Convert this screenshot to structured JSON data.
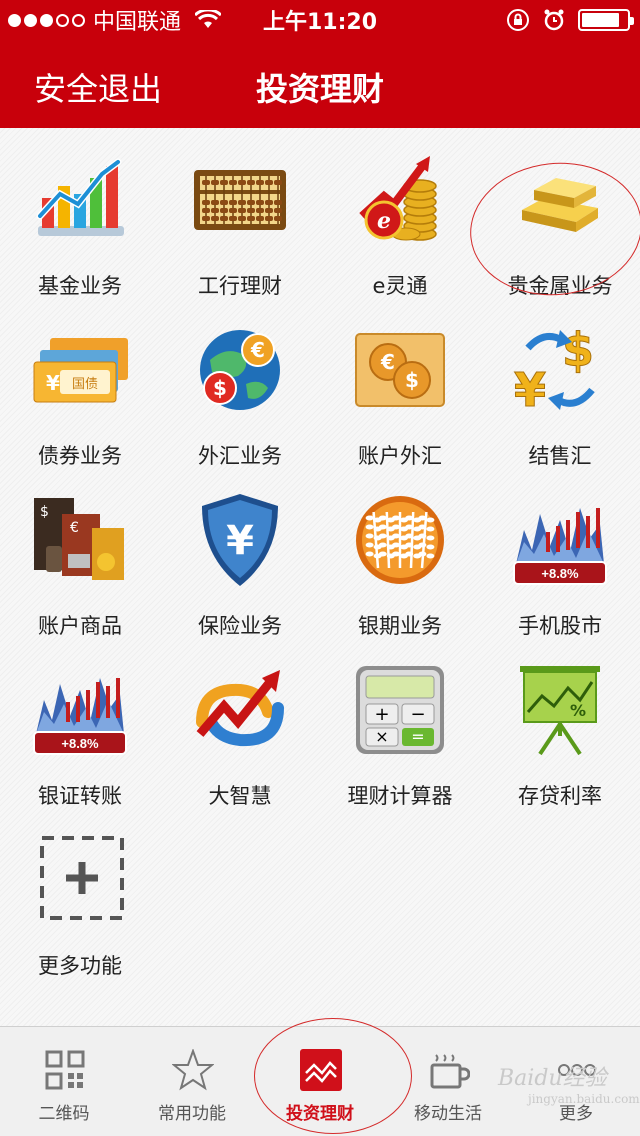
{
  "statusbar": {
    "carrier": "中国联通",
    "time": "上午11:20",
    "signal_bars": 3,
    "battery_level": 0.85
  },
  "header": {
    "left_label": "安全退出",
    "title": "投资理财"
  },
  "colors": {
    "brand_red": "#c8000b",
    "active_tab": "#d0101a"
  },
  "menu": [
    {
      "label": "基金业务",
      "icon": "fund-chart-icon"
    },
    {
      "label": "工行理财",
      "icon": "abacus-icon"
    },
    {
      "label": "e灵通",
      "icon": "e-coins-icon"
    },
    {
      "label": "贵金属业务",
      "icon": "gold-bars-icon"
    },
    {
      "label": "债券业务",
      "icon": "bond-notes-icon"
    },
    {
      "label": "外汇业务",
      "icon": "forex-globe-icon"
    },
    {
      "label": "账户外汇",
      "icon": "currency-coins-icon"
    },
    {
      "label": "结售汇",
      "icon": "yen-dollar-exchange-icon"
    },
    {
      "label": "账户商品",
      "icon": "commodities-icon"
    },
    {
      "label": "保险业务",
      "icon": "yen-shield-icon"
    },
    {
      "label": "银期业务",
      "icon": "wheat-icon"
    },
    {
      "label": "手机股市",
      "icon": "stock-chart-icon"
    },
    {
      "label": "银证转账",
      "icon": "stock-chart-icon"
    },
    {
      "label": "大智慧",
      "icon": "arrow-swirl-icon"
    },
    {
      "label": "理财计算器",
      "icon": "calculator-icon"
    },
    {
      "label": "存贷利率",
      "icon": "percent-easel-icon"
    },
    {
      "label": "更多功能",
      "icon": "add-more-icon"
    }
  ],
  "stock_badge": "+8.8%",
  "tabbar": [
    {
      "label": "二维码",
      "icon": "qr-code-icon",
      "active": false
    },
    {
      "label": "常用功能",
      "icon": "star-icon",
      "active": false
    },
    {
      "label": "投资理财",
      "icon": "investment-icon",
      "active": true
    },
    {
      "label": "移动生活",
      "icon": "coffee-cup-icon",
      "active": false
    },
    {
      "label": "更多",
      "icon": "more-dots-icon",
      "active": false
    }
  ],
  "watermark": {
    "brand": "Baidu经验",
    "url": "jingyan.baidu.com"
  }
}
